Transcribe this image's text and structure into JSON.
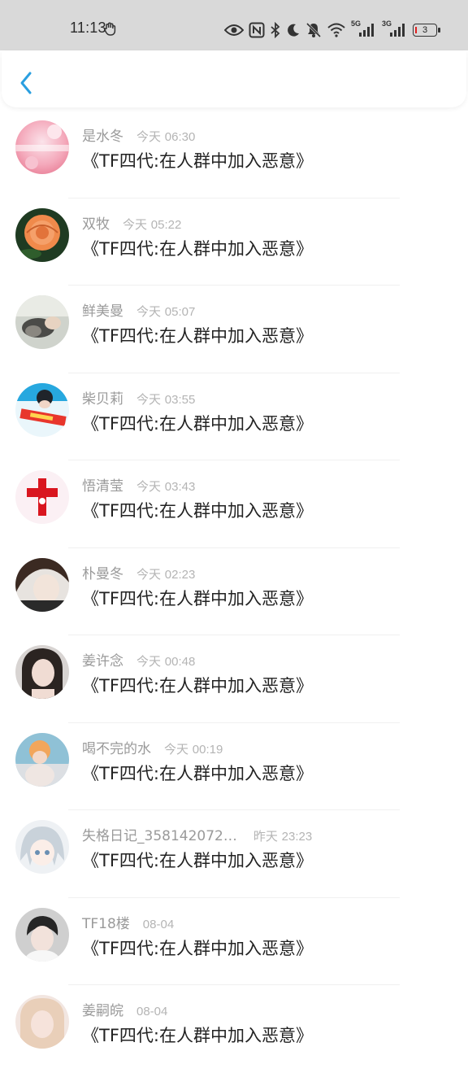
{
  "status_bar": {
    "time": "11:13",
    "net1": "5G",
    "net2": "3G",
    "battery": "3"
  },
  "header": {
    "back_icon": "chevron-left-icon",
    "accent": "#2a9fe0"
  },
  "messages": [
    {
      "name": "是水冬",
      "day": "今天",
      "time": "06:30",
      "text": "《TF四代:在人群中加入恶意》"
    },
    {
      "name": "双牧",
      "day": "今天",
      "time": "05:22",
      "text": "《TF四代:在人群中加入恶意》"
    },
    {
      "name": "鲜美曼",
      "day": "今天",
      "time": "05:07",
      "text": "《TF四代:在人群中加入恶意》"
    },
    {
      "name": "柴贝莉",
      "day": "今天",
      "time": "03:55",
      "text": "《TF四代:在人群中加入恶意》"
    },
    {
      "name": "悟清莹",
      "day": "今天",
      "time": "03:43",
      "text": "《TF四代:在人群中加入恶意》"
    },
    {
      "name": "朴曼冬",
      "day": "今天",
      "time": "02:23",
      "text": "《TF四代:在人群中加入恶意》"
    },
    {
      "name": "姜许念",
      "day": "今天",
      "time": "00:48",
      "text": "《TF四代:在人群中加入恶意》"
    },
    {
      "name": "喝不完的水",
      "day": "今天",
      "time": "00:19",
      "text": "《TF四代:在人群中加入恶意》"
    },
    {
      "name": "失格日记_358142072…",
      "day": "昨天",
      "time": "23:23",
      "text": "《TF四代:在人群中加入恶意》"
    },
    {
      "name": "TF18楼",
      "day": "",
      "time": "08-04",
      "text": "《TF四代:在人群中加入恶意》"
    },
    {
      "name": "姜嗣皖",
      "day": "",
      "time": "08-04",
      "text": "《TF四代:在人群中加入恶意》"
    }
  ]
}
